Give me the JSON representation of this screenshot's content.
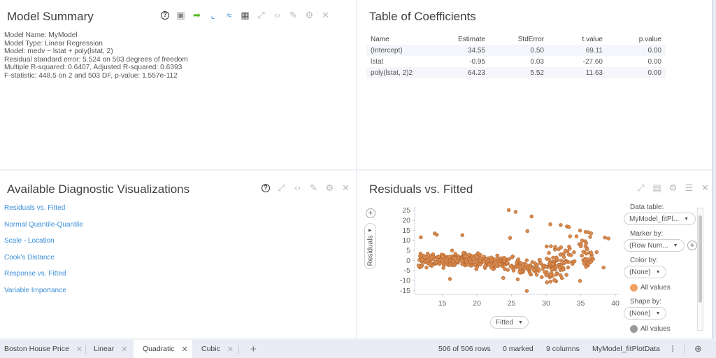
{
  "model_summary": {
    "title": "Model Summary",
    "lines": [
      "Model Name: MyModel",
      "Model Type: Linear Regression",
      "Model: medv ~ lstat + poly(lstat, 2)",
      "Residual standard error: 5.524 on 503 degrees of freedom",
      "Multiple R-squared: 0.6407, Adjusted R-squared: 0.6393",
      "F-statistic: 448.5 on 2 and 503 DF, p-value: 1.557e-112"
    ],
    "toolbar_icons": [
      "help-icon",
      "copy-visual-icon",
      "export-icon",
      "line-chart-icon",
      "curve-chart-icon",
      "calculator-icon",
      "maximize-icon",
      "code-icon",
      "edit-icon",
      "settings-icon",
      "close-icon"
    ]
  },
  "coefficients": {
    "title": "Table of Coefficients",
    "columns": [
      "Name",
      "Estimate",
      "StdError",
      "t.value",
      "p.value"
    ],
    "rows": [
      [
        "(Intercept)",
        "34.55",
        "0.50",
        "69.11",
        "0.00"
      ],
      [
        "lstat",
        "-0.95",
        "0.03",
        "-27.60",
        "0.00"
      ],
      [
        "poly(lstat, 2)2",
        "64.23",
        "5.52",
        "11.63",
        "0.00"
      ]
    ]
  },
  "diagnostics": {
    "title": "Available Diagnostic Visualizations",
    "links": [
      "Residuals vs. Fitted",
      "Normal Quantile-Quantile",
      "Scale - Location",
      "Cook's Distance",
      "Response vs. Fitted",
      "Variable Importance"
    ]
  },
  "residuals_panel": {
    "title": "Residuals vs. Fitted",
    "y_axis_selector": "Residuals",
    "x_axis_selector": "Fitted",
    "legend": {
      "data_table_label": "Data table:",
      "data_table_value": "MyModel_fitPl...",
      "marker_by_label": "Marker by:",
      "marker_by_value": "(Row Num...",
      "color_by_label": "Color by:",
      "color_by_value": "(None)",
      "color_item": "All values",
      "shape_by_label": "Shape by:",
      "shape_by_value": "(None)",
      "shape_item": "All values"
    },
    "colors": {
      "marker": "#d98a4e",
      "marker_stroke": "#a65a25",
      "legend_color": "#f2a163",
      "legend_shape": "#999999"
    }
  },
  "tabs": [
    {
      "label": "Boston House Price",
      "active": false
    },
    {
      "label": "Linear",
      "active": false
    },
    {
      "label": "Quadratic",
      "active": true
    },
    {
      "label": "Cubic",
      "active": false
    }
  ],
  "status": {
    "rows": "506 of 506 rows",
    "marked": "0 marked",
    "columns": "9 columns",
    "table": "MyModel_fitPlotData"
  },
  "chart_data": {
    "type": "scatter",
    "title": "Residuals vs. Fitted",
    "xlabel": "Fitted",
    "ylabel": "Residuals",
    "xlim": [
      11,
      40.5
    ],
    "ylim": [
      -17,
      27
    ],
    "xticks": [
      15,
      20,
      25,
      30,
      35,
      40
    ],
    "yticks": [
      25,
      20,
      15,
      10,
      5,
      0,
      -5,
      -10,
      -15
    ],
    "grid": false,
    "legend": "right",
    "n_points": 506,
    "notable_points": [
      [
        24.6,
        25.1
      ],
      [
        25.6,
        24.2
      ],
      [
        27.9,
        21.9
      ],
      [
        30.6,
        18.0
      ],
      [
        32.1,
        17.6
      ],
      [
        33.0,
        16.9
      ],
      [
        33.3,
        16.6
      ],
      [
        34.9,
        14.9
      ],
      [
        35.7,
        14.2
      ],
      [
        36.1,
        14.0
      ],
      [
        36.5,
        13.5
      ],
      [
        38.5,
        11.4
      ],
      [
        39.0,
        10.9
      ],
      [
        13.9,
        13.4
      ],
      [
        14.2,
        12.8
      ],
      [
        17.9,
        12.6
      ],
      [
        11.9,
        11.5
      ],
      [
        27.3,
        14.6
      ],
      [
        24.8,
        11.2
      ],
      [
        27.2,
        -15.3
      ],
      [
        16.1,
        -9.3
      ],
      [
        23.8,
        -8.8
      ],
      [
        25.9,
        -9.5
      ],
      [
        34.9,
        -10.3
      ],
      [
        38.3,
        -3.6
      ],
      [
        37.3,
        4.1
      ]
    ],
    "bulk_description": "dense band of points between fitted 11-23 centered near 0 (roughly -7 to 8); band drifts to -5 around fitted 26-33; wider spread above 30"
  }
}
